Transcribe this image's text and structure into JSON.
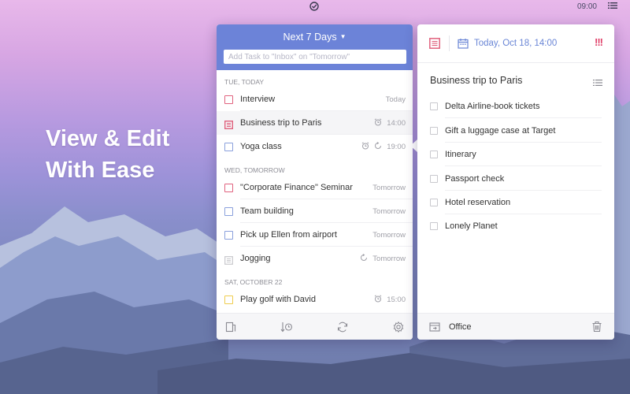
{
  "menubar": {
    "time": "09:00",
    "tray_icon": "check-circle-icon",
    "list_icon": "menu-list-icon"
  },
  "hero": {
    "line1": "View & Edit",
    "line2": "With Ease"
  },
  "task_panel": {
    "title": "Next 7 Days",
    "add_task_placeholder": "Add Task to \"Inbox\" on \"Tomorrow\"",
    "groups": [
      {
        "label": "TUE, TODAY",
        "tasks": [
          {
            "title": "Interview",
            "meta": "Today",
            "checkbox_color": "#e0627e"
          },
          {
            "title": "Business trip to Paris",
            "meta": "14:00",
            "checkbox": "note-red",
            "icons": [
              "alarm-icon"
            ]
          },
          {
            "title": "Yoga class",
            "meta": "19:00",
            "checkbox_color": "#8aa0dc",
            "icons": [
              "alarm-icon",
              "repeat-icon"
            ]
          }
        ]
      },
      {
        "label": "WED, TOMORROW",
        "tasks": [
          {
            "title": "\"Corporate Finance\" Seminar",
            "meta": "Tomorrow",
            "checkbox_color": "#e0627e"
          },
          {
            "title": "Team building",
            "meta": "Tomorrow",
            "checkbox_color": "#8aa0dc"
          },
          {
            "title": "Pick up Ellen from airport",
            "meta": "Tomorrow",
            "checkbox_color": "#8aa0dc"
          },
          {
            "title": "Jogging",
            "meta": "Tomorrow",
            "checkbox": "note-gray",
            "icons": [
              "repeat-icon"
            ]
          }
        ]
      },
      {
        "label": "SAT, OCTOBER 22",
        "tasks": [
          {
            "title": "Play golf with David",
            "meta": "15:00",
            "checkbox_color": "#efcc4d",
            "icons": [
              "alarm-icon"
            ]
          }
        ]
      }
    ],
    "footer_icons": [
      "clipboard-icon",
      "sort-time-icon",
      "sync-icon",
      "settings-icon"
    ]
  },
  "detail_panel": {
    "date": "Today, Oct 18, 14:00",
    "priority": "!!!",
    "title": "Business trip to Paris",
    "checklist": [
      "Delta Airline-book tickets",
      "Gift a luggage case at Target",
      "Itinerary",
      "Passport check",
      "Hotel reservation",
      "Lonely Planet"
    ],
    "list_name": "Office"
  },
  "colors": {
    "accent": "#6c83d8",
    "date_blue": "#6a86d6",
    "priority_red": "#e0436b",
    "note_red": "#e0627e"
  }
}
